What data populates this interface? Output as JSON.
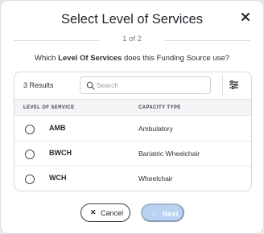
{
  "dialog": {
    "title": "Select Level of Services",
    "step": "1 of 2",
    "question_prefix": "Which ",
    "question_bold": "Level Of Services",
    "question_suffix": " does this Funding Source use?"
  },
  "toolbar": {
    "results": "3 Results",
    "search_placeholder": "Search"
  },
  "table": {
    "headers": [
      "LEVEL OF SERVICE",
      "CAPACITY TYPE"
    ],
    "rows": [
      {
        "code": "AMB",
        "type": "Ambulatory",
        "selected": false
      },
      {
        "code": "BWCH",
        "type": "Bariatric Wheelchair",
        "selected": false
      },
      {
        "code": "WCH",
        "type": "Wheelchair",
        "selected": false
      }
    ]
  },
  "footer": {
    "cancel_label": "Cancel",
    "next_label": "Next",
    "next_enabled": false
  },
  "colors": {
    "accent_disabled": "#b9d2f3",
    "border": "#d8d9de",
    "header_bg": "#f3f4f6"
  },
  "icons": {
    "close": "close-icon",
    "search": "search-icon",
    "filter": "filter-sliders-icon",
    "cancel": "close-icon",
    "next": "arrow-right-icon"
  }
}
